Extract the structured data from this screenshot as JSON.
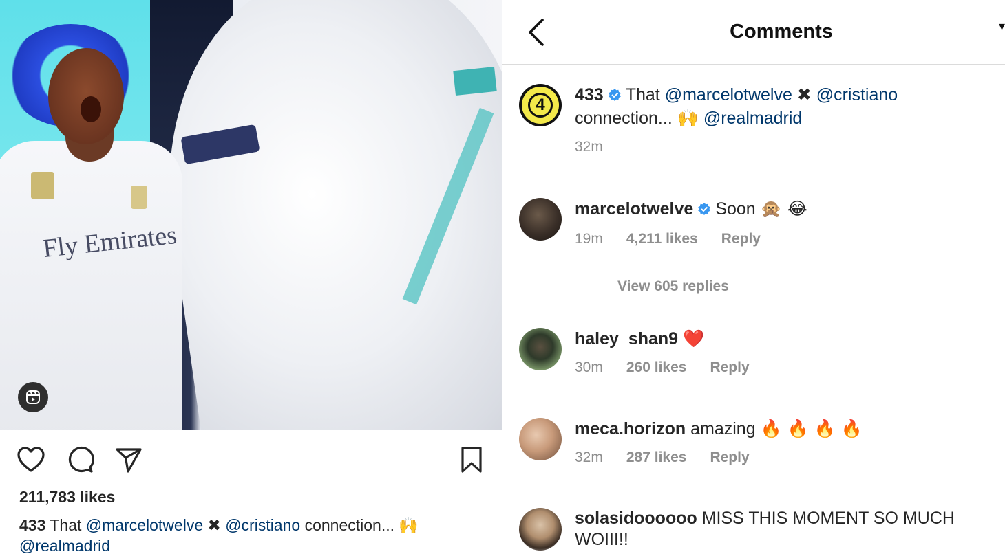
{
  "post": {
    "likes": "211,783 likes",
    "caption_user": "433",
    "caption_text_1": "That",
    "caption_mention_1": "@marcelotwelve",
    "caption_cross": "✖",
    "caption_mention_2": "@cristiano",
    "caption_text_2": "connection...",
    "caption_emoji": "🙌",
    "caption_mention_3": "@realmadrid",
    "media_text": "Fly Emirates",
    "icons": [
      "heart-icon",
      "comment-icon",
      "share-icon",
      "bookmark-icon",
      "reels-icon"
    ]
  },
  "comments_page": {
    "title": "Comments",
    "back_icon": "chevron-left-icon",
    "edge_glyph": "▾"
  },
  "original_post": {
    "user": "433",
    "avatar_text": "4",
    "text_1": "That",
    "mention_1": "@marcelotwelve",
    "cross": "✖",
    "mention_2": "@cristiano",
    "text_2": "connection...",
    "emoji": "🙌",
    "mention_3": "@realmadrid",
    "time": "32m"
  },
  "comments": [
    {
      "user": "marcelotwelve",
      "verified": true,
      "text": "Soon",
      "emoji": "🙊 😂",
      "time": "19m",
      "likes": "4,211 likes",
      "reply": "Reply"
    },
    {
      "user": "haley_shan9",
      "verified": false,
      "text": "",
      "emoji": "❤️",
      "time": "30m",
      "likes": "260 likes",
      "reply": "Reply"
    },
    {
      "user": "meca.horizon",
      "verified": false,
      "text": "amazing",
      "emoji": "🔥 🔥 🔥 🔥",
      "time": "32m",
      "likes": "287 likes",
      "reply": "Reply"
    },
    {
      "user": "solasidoooooo",
      "verified": false,
      "text": "MISS THIS MOMENT SO MUCH WOIII!!",
      "emoji": "",
      "time": "",
      "likes": "",
      "reply": ""
    }
  ],
  "view_replies": "View 605 replies",
  "colors": {
    "verified": "#3897f0",
    "mention": "#00376b",
    "meta": "#8e8e8e",
    "avatar_433_bg": "#f3e94a"
  }
}
